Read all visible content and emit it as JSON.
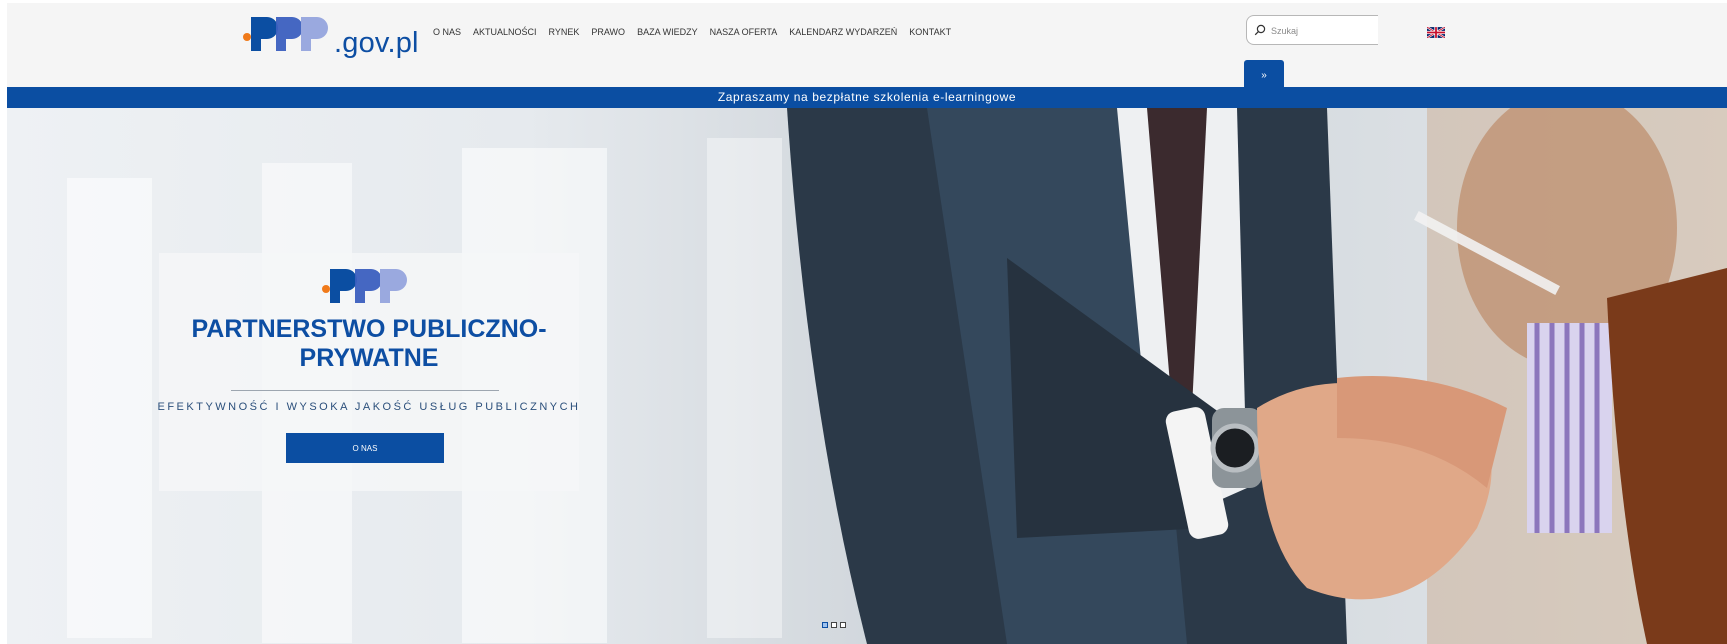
{
  "header": {
    "logo": {
      "mark": "PPP",
      "domain": ".gov.pl"
    },
    "nav": [
      {
        "label": "O NAS"
      },
      {
        "label": "AKTUALNOŚCI"
      },
      {
        "label": "RYNEK"
      },
      {
        "label": "PRAWO"
      },
      {
        "label": "BAZA WIEDZY"
      },
      {
        "label": "NASZA OFERTA"
      },
      {
        "label": "KALENDARZ WYDARZEŃ"
      },
      {
        "label": "KONTAKT"
      }
    ],
    "search": {
      "placeholder": "Szukaj",
      "value": "",
      "button_label": "»"
    },
    "language_icon": "uk-flag-icon"
  },
  "banner": {
    "text": "Zapraszamy na bezpłatne szkolenia e-learningowe"
  },
  "hero": {
    "title": "PARTNERSTWO PUBLICZNO-PRYWATNE",
    "subtitle": "EFEKTYWNOŚĆ I WYSOKA JAKOŚĆ USŁUG PUBLICZNYCH",
    "button_label": "O NAS",
    "slides_total": 3,
    "slide_active": 1
  },
  "colors": {
    "brand_blue": "#0b4ea2",
    "accent_orange": "#f07a1a",
    "light_blue": "#9aa9df"
  }
}
